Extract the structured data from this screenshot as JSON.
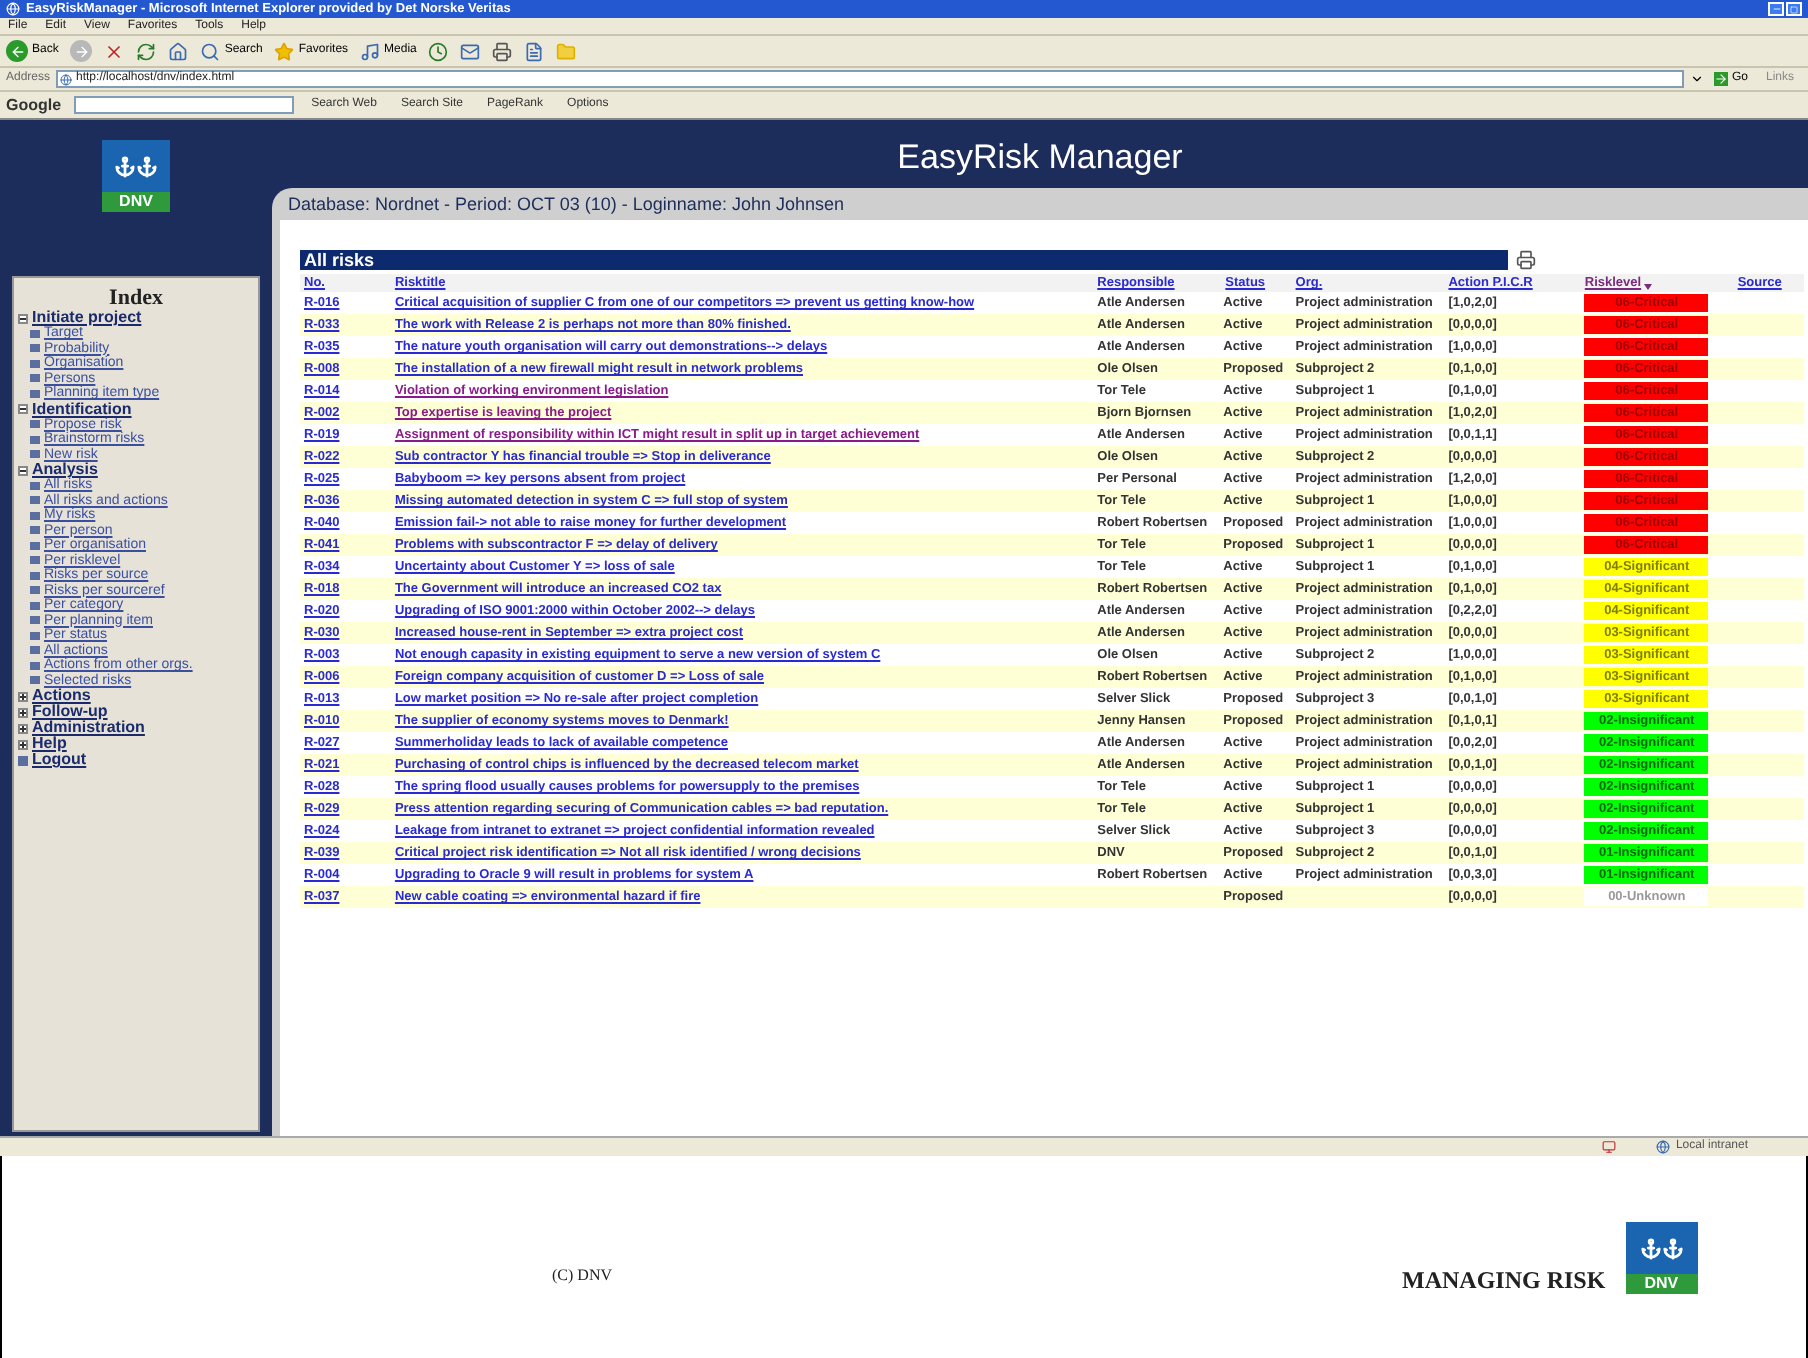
{
  "window": {
    "title": "EasyRiskManager - Microsoft Internet Explorer provided by Det Norske Veritas"
  },
  "menu": [
    "File",
    "Edit",
    "View",
    "Favorites",
    "Tools",
    "Help"
  ],
  "toolbar": {
    "back": "Back",
    "search": "Search",
    "favorites": "Favorites",
    "media": "Media"
  },
  "address_bar": {
    "label": "Address",
    "url": "http://localhost/dnv/index.html",
    "go": "Go",
    "links": "Links"
  },
  "google_bar": {
    "label": "Google",
    "buttons": [
      "Search Web",
      "Search Site",
      "PageRank",
      "Options"
    ]
  },
  "app": {
    "logo": "DNV",
    "title": "EasyRisk Manager",
    "info": "Database: Nordnet - Period: OCT 03 (10) - Loginname: John Johnsen"
  },
  "index": {
    "title": "Index",
    "items": [
      {
        "label": "Initiate project",
        "kind": "section",
        "expanded": true,
        "children": [
          {
            "label": "Target"
          },
          {
            "label": "Probability"
          },
          {
            "label": "Organisation"
          },
          {
            "label": "Persons"
          },
          {
            "label": "Planning item type"
          }
        ]
      },
      {
        "label": "Identification",
        "kind": "section",
        "expanded": true,
        "children": [
          {
            "label": "Propose risk"
          },
          {
            "label": "Brainstorm risks"
          },
          {
            "label": "New risk"
          }
        ]
      },
      {
        "label": "Analysis",
        "kind": "section",
        "expanded": true,
        "children": [
          {
            "label": "All risks"
          },
          {
            "label": "All risks and actions"
          },
          {
            "label": "My risks"
          },
          {
            "label": "Per person"
          },
          {
            "label": "Per organisation"
          },
          {
            "label": "Per risklevel"
          },
          {
            "label": "Risks per source"
          },
          {
            "label": "Risks per sourceref"
          },
          {
            "label": "Per category"
          },
          {
            "label": "Per planning item"
          },
          {
            "label": "Per status"
          },
          {
            "label": "All actions"
          },
          {
            "label": "Actions from other orgs."
          },
          {
            "label": "Selected risks"
          }
        ]
      },
      {
        "label": "Actions",
        "kind": "section",
        "expanded": false
      },
      {
        "label": "Follow-up",
        "kind": "section",
        "expanded": false
      },
      {
        "label": "Administration",
        "kind": "section",
        "expanded": false
      },
      {
        "label": "Help",
        "kind": "section",
        "expanded": false
      },
      {
        "label": "Logout",
        "kind": "link"
      }
    ]
  },
  "table": {
    "title": "All risks",
    "columns": [
      {
        "label": "No.",
        "sorted": false
      },
      {
        "label": "Risktitle",
        "sorted": false
      },
      {
        "label": "Responsible",
        "sorted": false
      },
      {
        "label": "Status",
        "sorted": false
      },
      {
        "label": "Org.",
        "sorted": false
      },
      {
        "label": "Action P.I.C.R",
        "sorted": false
      },
      {
        "label": "Risklevel",
        "sorted": true
      },
      {
        "label": "Source",
        "sorted": false
      }
    ],
    "rows": [
      {
        "no": "R-016",
        "title": "Critical acquisition of supplier C from one of our competitors => prevent us getting know-how",
        "visited": false,
        "responsible": "Atle Andersen",
        "status": "Active",
        "org": "Project administration",
        "action": "[1,0,2,0]",
        "level": "06-Critical",
        "color": "#ff0000"
      },
      {
        "no": "R-033",
        "title": "The work with Release 2 is perhaps not more than 80% finished.",
        "visited": false,
        "responsible": "Atle Andersen",
        "status": "Active",
        "org": "Project administration",
        "action": "[0,0,0,0]",
        "level": "06-Critical",
        "color": "#ff0000"
      },
      {
        "no": "R-035",
        "title": "The nature youth organisation will carry out demonstrations--> delays",
        "visited": false,
        "responsible": "Atle Andersen",
        "status": "Active",
        "org": "Project administration",
        "action": "[1,0,0,0]",
        "level": "06-Critical",
        "color": "#ff0000"
      },
      {
        "no": "R-008",
        "title": "The installation of a new firewall might result in network problems",
        "visited": false,
        "responsible": "Ole Olsen",
        "status": "Proposed",
        "org": "Subproject 2",
        "action": "[0,1,0,0]",
        "level": "06-Critical",
        "color": "#ff0000"
      },
      {
        "no": "R-014",
        "title": "Violation of working environment legislation",
        "visited": true,
        "responsible": "Tor Tele",
        "status": "Active",
        "org": "Subproject 1",
        "action": "[0,1,0,0]",
        "level": "06-Critical",
        "color": "#ff0000"
      },
      {
        "no": "R-002",
        "title": "Top expertise is leaving the project",
        "visited": true,
        "responsible": "Bjorn Bjornsen",
        "status": "Active",
        "org": "Project administration",
        "action": "[1,0,2,0]",
        "level": "06-Critical",
        "color": "#ff0000"
      },
      {
        "no": "R-019",
        "title": "Assignment of responsibility within ICT might result in split up in target achievement",
        "visited": true,
        "responsible": "Atle Andersen",
        "status": "Active",
        "org": "Project administration",
        "action": "[0,0,1,1]",
        "level": "06-Critical",
        "color": "#ff0000"
      },
      {
        "no": "R-022",
        "title": "Sub contractor Y has financial trouble => Stop in deliverance",
        "visited": false,
        "responsible": "Ole Olsen",
        "status": "Active",
        "org": "Subproject 2",
        "action": "[0,0,0,0]",
        "level": "06-Critical",
        "color": "#ff0000"
      },
      {
        "no": "R-025",
        "title": "Babyboom => key persons absent from project",
        "visited": false,
        "responsible": "Per Personal",
        "status": "Active",
        "org": "Project administration",
        "action": "[1,2,0,0]",
        "level": "06-Critical",
        "color": "#ff0000"
      },
      {
        "no": "R-036",
        "title": "Missing automated detection in system C => full stop of system",
        "visited": false,
        "responsible": "Tor Tele",
        "status": "Active",
        "org": "Subproject 1",
        "action": "[1,0,0,0]",
        "level": "06-Critical",
        "color": "#ff0000"
      },
      {
        "no": "R-040",
        "title": "Emission fail-> not able to raise money for further development",
        "visited": false,
        "responsible": "Robert Robertsen",
        "status": "Proposed",
        "org": "Project administration",
        "action": "[1,0,0,0]",
        "level": "06-Critical",
        "color": "#ff0000"
      },
      {
        "no": "R-041",
        "title": "Problems with subscontractor F => delay of delivery",
        "visited": false,
        "responsible": "Tor Tele",
        "status": "Proposed",
        "org": "Subproject 1",
        "action": "[0,0,0,0]",
        "level": "06-Critical",
        "color": "#ff0000"
      },
      {
        "no": "R-034",
        "title": "Uncertainty about Customer Y => loss of sale",
        "visited": false,
        "responsible": "Tor Tele",
        "status": "Active",
        "org": "Subproject 1",
        "action": "[0,1,0,0]",
        "level": "04-Significant",
        "color": "#ffff00"
      },
      {
        "no": "R-018",
        "title": "The Government will introduce an increased CO2 tax",
        "visited": false,
        "responsible": "Robert Robertsen",
        "status": "Active",
        "org": "Project administration",
        "action": "[0,1,0,0]",
        "level": "04-Significant",
        "color": "#ffff00"
      },
      {
        "no": "R-020",
        "title": "Upgrading of ISO 9001:2000 within October 2002--> delays",
        "visited": false,
        "responsible": "Atle Andersen",
        "status": "Active",
        "org": "Project administration",
        "action": "[0,2,2,0]",
        "level": "04-Significant",
        "color": "#ffff00"
      },
      {
        "no": "R-030",
        "title": "Increased house-rent in September => extra project cost",
        "visited": false,
        "responsible": "Atle Andersen",
        "status": "Active",
        "org": "Project administration",
        "action": "[0,0,0,0]",
        "level": "03-Significant",
        "color": "#ffff00"
      },
      {
        "no": "R-003",
        "title": "Not enough capasity in existing equipment to serve a new version of system C",
        "visited": false,
        "responsible": "Ole Olsen",
        "status": "Active",
        "org": "Subproject 2",
        "action": "[1,0,0,0]",
        "level": "03-Significant",
        "color": "#ffff00"
      },
      {
        "no": "R-006",
        "title": "Foreign company acquisition of customer D => Loss of sale",
        "visited": false,
        "responsible": "Robert Robertsen",
        "status": "Active",
        "org": "Project administration",
        "action": "[0,1,0,0]",
        "level": "03-Significant",
        "color": "#ffff00"
      },
      {
        "no": "R-013",
        "title": "Low market position => No re-sale after project completion",
        "visited": false,
        "responsible": "Selver Slick",
        "status": "Proposed",
        "org": "Subproject 3",
        "action": "[0,0,1,0]",
        "level": "03-Significant",
        "color": "#ffff00"
      },
      {
        "no": "R-010",
        "title": "The supplier of economy systems moves to Denmark!",
        "visited": false,
        "responsible": "Jenny Hansen",
        "status": "Proposed",
        "org": "Project administration",
        "action": "[0,1,0,1]",
        "level": "02-Insignificant",
        "color": "#00ff00"
      },
      {
        "no": "R-027",
        "title": "Summerholiday leads to lack of available competence",
        "visited": false,
        "responsible": "Atle Andersen",
        "status": "Active",
        "org": "Project administration",
        "action": "[0,0,2,0]",
        "level": "02-Insignificant",
        "color": "#00ff00"
      },
      {
        "no": "R-021",
        "title": "Purchasing of control chips is influenced by the decreased telecom market",
        "visited": false,
        "responsible": "Atle Andersen",
        "status": "Active",
        "org": "Project administration",
        "action": "[0,0,1,0]",
        "level": "02-Insignificant",
        "color": "#00ff00"
      },
      {
        "no": "R-028",
        "title": "The spring flood usually causes problems for powersupply to the premises",
        "visited": false,
        "responsible": "Tor Tele",
        "status": "Active",
        "org": "Subproject 1",
        "action": "[0,0,0,0]",
        "level": "02-Insignificant",
        "color": "#00ff00"
      },
      {
        "no": "R-029",
        "title": "Press attention regarding securing of Communication cables => bad reputation.",
        "visited": false,
        "responsible": "Tor Tele",
        "status": "Active",
        "org": "Subproject 1",
        "action": "[0,0,0,0]",
        "level": "02-Insignificant",
        "color": "#00ff00"
      },
      {
        "no": "R-024",
        "title": "Leakage from intranet to extranet => project confidential information revealed",
        "visited": false,
        "responsible": "Selver Slick",
        "status": "Active",
        "org": "Subproject 3",
        "action": "[0,0,0,0]",
        "level": "02-Insignificant",
        "color": "#00ff00"
      },
      {
        "no": "R-039",
        "title": "Critical project risk identification => Not all risk identified / wrong decisions",
        "visited": false,
        "responsible": "DNV",
        "status": "Proposed",
        "org": "Subproject 2",
        "action": "[0,0,1,0]",
        "level": "01-Insignificant",
        "color": "#00ff00"
      },
      {
        "no": "R-004",
        "title": "Upgrading to Oracle 9 will result in problems for system A",
        "visited": false,
        "responsible": "Robert Robertsen",
        "status": "Active",
        "org": "Project administration",
        "action": "[0,0,3,0]",
        "level": "01-Insignificant",
        "color": "#00ff00"
      },
      {
        "no": "R-037",
        "title": "New cable coating => environmental hazard if fire",
        "visited": false,
        "status": "Proposed",
        "action": "[0,0,0,0]",
        "level": "00-Unknown",
        "color": "#ffffff"
      }
    ]
  },
  "status_bar": {
    "zone": "Local intranet"
  },
  "footer": {
    "copyright": "(C) DNV",
    "slogan": "MANAGING RISK",
    "logo": "DNV"
  }
}
